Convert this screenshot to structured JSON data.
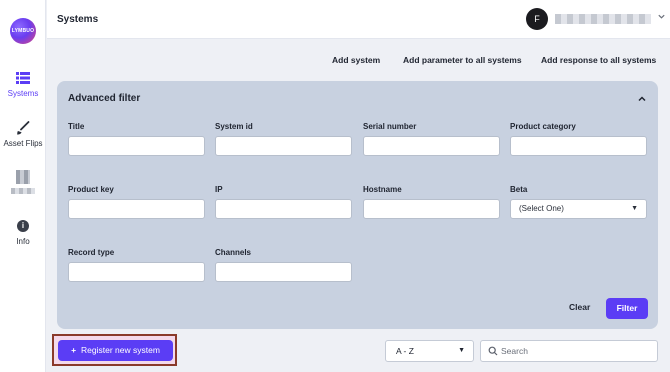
{
  "sidebar": {
    "logo_text": "LYMBUO",
    "items": [
      {
        "label": "Systems",
        "icon": "list-icon",
        "active": true
      },
      {
        "label": "Asset Flips",
        "icon": "brush-icon",
        "active": false
      },
      {
        "label": "",
        "icon": "blurred-icon",
        "active": false
      },
      {
        "label": "Info",
        "icon": "info-icon",
        "active": false
      }
    ]
  },
  "header": {
    "title": "Systems",
    "avatar_initial": "F"
  },
  "actions": {
    "add_system": "Add system",
    "add_parameter": "Add parameter to all systems",
    "add_response": "Add response to all systems"
  },
  "filter": {
    "title": "Advanced filter",
    "fields": {
      "title": {
        "label": "Title",
        "value": ""
      },
      "system_id": {
        "label": "System id",
        "value": ""
      },
      "serial_number": {
        "label": "Serial number",
        "value": ""
      },
      "product_category": {
        "label": "Product category",
        "value": ""
      },
      "product_key": {
        "label": "Product key",
        "value": ""
      },
      "ip": {
        "label": "IP",
        "value": ""
      },
      "hostname": {
        "label": "Hostname",
        "value": ""
      },
      "beta": {
        "label": "Beta",
        "value": "(Select One)"
      },
      "record_type": {
        "label": "Record type",
        "value": ""
      },
      "channels": {
        "label": "Channels",
        "value": ""
      }
    },
    "clear_label": "Clear",
    "filter_label": "Filter"
  },
  "bottom": {
    "register_label": "Register new system",
    "sort_value": "A - Z",
    "search_placeholder": "Search"
  },
  "colors": {
    "accent": "#5b3df5",
    "filter_panel": "#c8d1e0",
    "background": "#eef0f5"
  }
}
